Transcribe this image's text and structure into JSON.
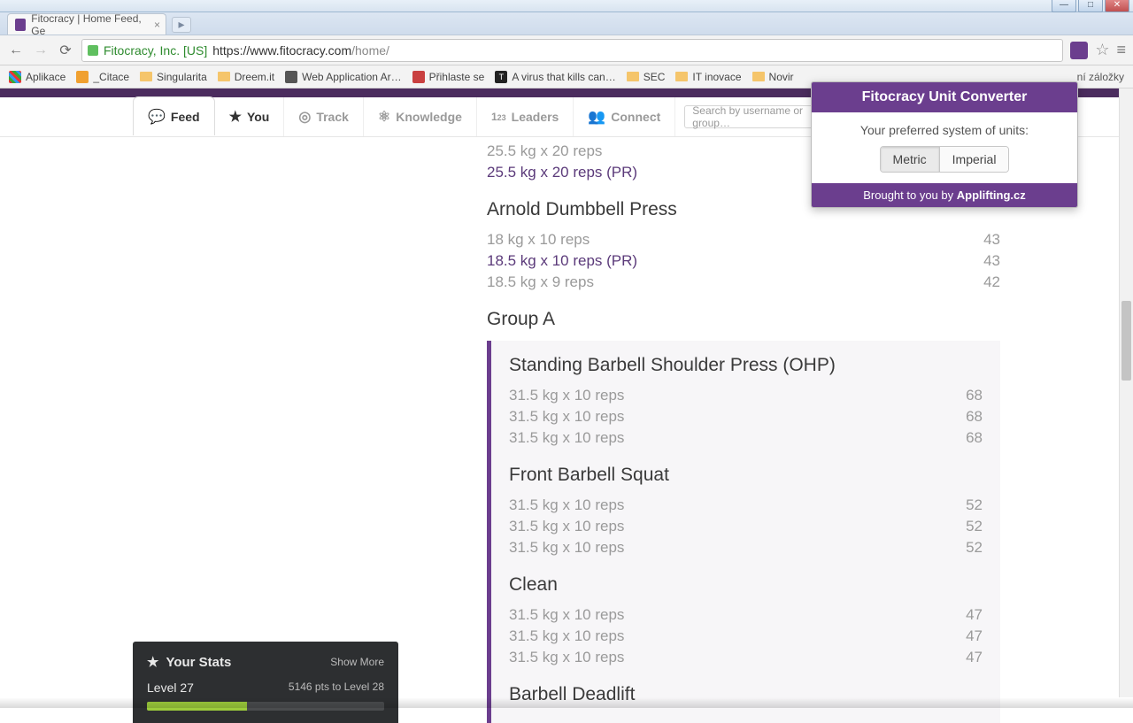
{
  "window": {
    "tab_title": "Fitocracy | Home Feed, Ge"
  },
  "toolbar": {
    "org": "Fitocracy, Inc. [US]",
    "url_host": "https://www.fitocracy.com",
    "url_path": "/home/"
  },
  "bookmarks": {
    "apps": "Aplikace",
    "items": [
      "_Citace",
      "Singularita",
      "Dreem.it",
      "Web Application Ar…",
      "Přihlaste se",
      "A virus that kills can…",
      "SEC",
      "IT inovace",
      "Novir"
    ],
    "other": "ní záložky"
  },
  "nav": {
    "feed": "Feed",
    "you": "You",
    "track": "Track",
    "knowledge": "Knowledge",
    "leaders": "Leaders",
    "connect": "Connect",
    "search_placeholder": "Search by username or group…"
  },
  "workout": {
    "top_sets": [
      {
        "set": "25.5 kg x 20 reps",
        "pr": false
      },
      {
        "set": "25.5 kg x 20 reps (PR)",
        "pr": true
      }
    ],
    "ex1": {
      "title": "Arnold Dumbbell Press",
      "sets": [
        {
          "set": "18 kg x 10 reps",
          "pts": "43",
          "pr": false
        },
        {
          "set": "18.5 kg x 10 reps (PR)",
          "pts": "43",
          "pr": true
        },
        {
          "set": "18.5 kg x 9 reps",
          "pts": "42",
          "pr": false
        }
      ]
    },
    "group_title": "Group A",
    "group": [
      {
        "title": "Standing Barbell Shoulder Press (OHP)",
        "sets": [
          {
            "set": "31.5 kg x 10 reps",
            "pts": "68"
          },
          {
            "set": "31.5 kg x 10 reps",
            "pts": "68"
          },
          {
            "set": "31.5 kg x 10 reps",
            "pts": "68"
          }
        ]
      },
      {
        "title": "Front Barbell Squat",
        "sets": [
          {
            "set": "31.5 kg x 10 reps",
            "pts": "52"
          },
          {
            "set": "31.5 kg x 10 reps",
            "pts": "52"
          },
          {
            "set": "31.5 kg x 10 reps",
            "pts": "52"
          }
        ]
      },
      {
        "title": "Clean",
        "sets": [
          {
            "set": "31.5 kg x 10 reps",
            "pts": "47"
          },
          {
            "set": "31.5 kg x 10 reps",
            "pts": "47"
          },
          {
            "set": "31.5 kg x 10 reps",
            "pts": "47"
          }
        ]
      },
      {
        "title": "Barbell Deadlift",
        "sets": []
      }
    ]
  },
  "stats": {
    "title": "Your Stats",
    "show_more": "Show More",
    "level": "Level 27",
    "progress_text": "5146 pts to Level 28"
  },
  "popup": {
    "title": "Fitocracy Unit Converter",
    "label": "Your preferred system of units:",
    "metric": "Metric",
    "imperial": "Imperial",
    "foot_pre": "Brought to you by ",
    "foot_link": "Applifting.cz"
  }
}
